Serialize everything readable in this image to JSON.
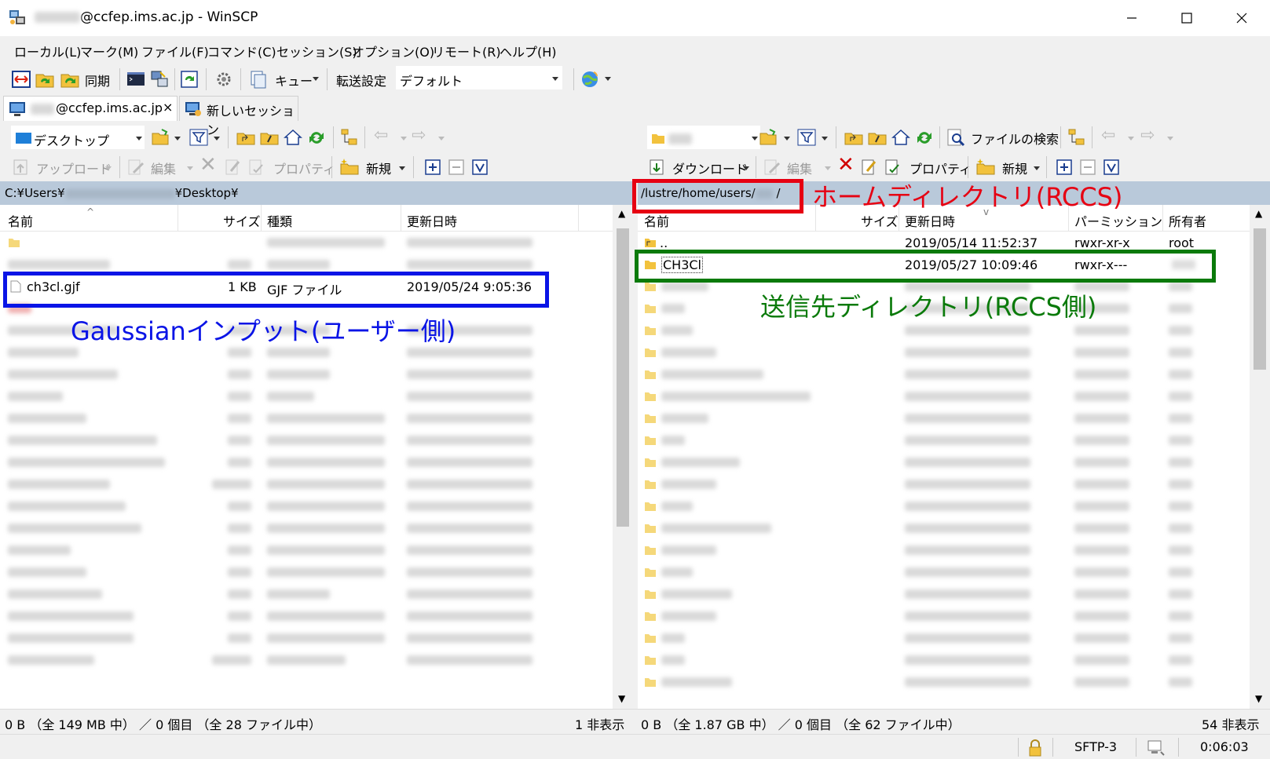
{
  "window": {
    "title": "@ccfep.ims.ac.jp - WinSCP"
  },
  "menu": [
    "ローカル(L)",
    "マーク(M)",
    "ファイル(F)",
    "コマンド(C)",
    "セッション(S)",
    "オプション(O)",
    "リモート(R)",
    "ヘルプ(H)"
  ],
  "toolbar": {
    "sync_label": "同期",
    "queue_label": "キュー",
    "transfer_label": "転送設定",
    "transfer_value": "デフォルト"
  },
  "tabs": {
    "session_label": "@ccfep.ims.ac.jp",
    "new_session_label": "新しいセッション"
  },
  "left": {
    "location": "デスクトップ",
    "upload_label": "アップロード",
    "edit_label": "編集",
    "properties_label": "プロパティ",
    "new_label": "新規",
    "path_prefix": "C:¥Users¥",
    "path_suffix": "¥Desktop¥",
    "columns": {
      "name": "名前",
      "size": "サイズ",
      "type": "種類",
      "modified": "更新日時"
    },
    "file": {
      "name": "ch3cl.gjf",
      "size": "1 KB",
      "type": "GJF ファイル",
      "modified": "2019/05/24  9:05:36"
    },
    "status": "0 B （全 149 MB 中） ／ 0 個目 （全 28 ファイル中）",
    "hidden": "1 非表示"
  },
  "right": {
    "find_label": "ファイルの検索",
    "download_label": "ダウンロード",
    "edit_label": "編集",
    "properties_label": "プロパティ",
    "new_label": "新規",
    "path": "/lustre/home/users/",
    "path_end": "/",
    "columns": {
      "name": "名前",
      "size": "サイズ",
      "modified": "更新日時",
      "permissions": "パーミッション",
      "owner": "所有者"
    },
    "parent": {
      "name": "..",
      "modified": "2019/05/14 11:52:37",
      "permissions": "rwxr-xr-x",
      "owner": "root"
    },
    "dir": {
      "name": "CH3Cl",
      "modified": "2019/05/27 10:09:46",
      "permissions": "rwxr-x---"
    },
    "status": "0 B （全 1.87 GB 中） ／ 0 個目 （全 62 ファイル中）",
    "hidden": "54 非表示"
  },
  "bottom": {
    "protocol": "SFTP-3",
    "time": "0:06:03"
  },
  "annotations": {
    "home": "ホームディレクトリ(RCCS)",
    "input": "Gaussianインプット(ユーザー側)",
    "dest": "送信先ディレクトリ(RCCS側)"
  },
  "colors": {
    "red": "#e60012",
    "blue": "#0a14e6",
    "green": "#0a7a0a",
    "path_bg": "#b9c9da"
  }
}
